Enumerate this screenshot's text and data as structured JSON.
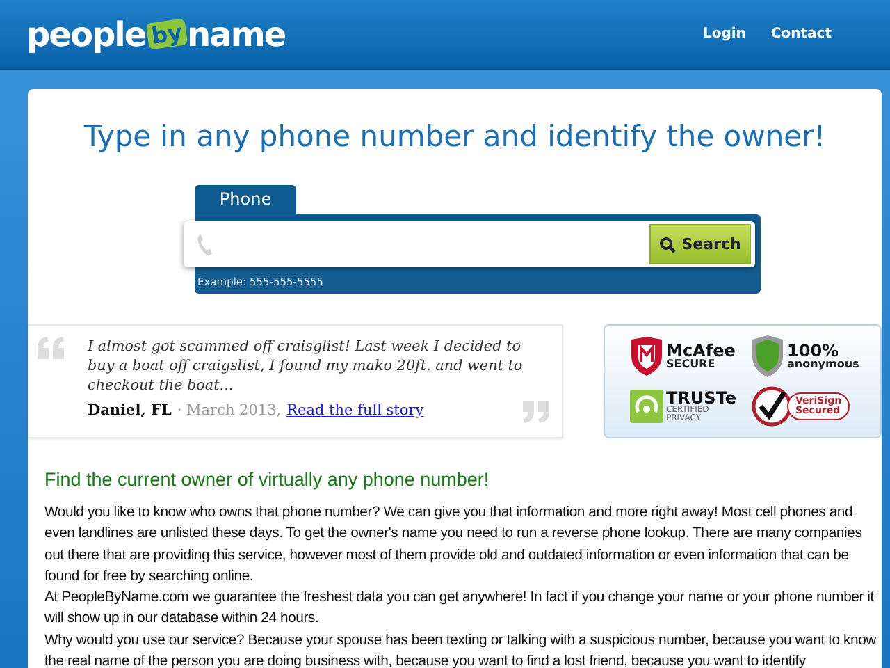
{
  "header": {
    "logo": {
      "part_1": "people",
      "part_2": "by",
      "part_3": "name"
    },
    "nav": [
      "Login",
      "Contact"
    ]
  },
  "title": "Type in any phone number and identify the owner!",
  "search": {
    "tabs": [
      {
        "label": "Phone",
        "selected": true
      }
    ],
    "button": "Search",
    "example": "Example: 555-555-5555"
  },
  "testimonial": {
    "quote": "I almost got scammed off craisglist! Last week I decided to buy a boat off craigslist, I found my mako 20ft. and went to checkout the boat...",
    "author": "Daniel, FL",
    "date": "· March 2013,",
    "link": "Read the full story"
  },
  "badges": [
    {
      "kind": "mcafee",
      "lines": [
        "McAfee",
        "SECURE"
      ]
    },
    {
      "kind": "anonymous",
      "lines": [
        "100%",
        "anonymous"
      ]
    },
    {
      "kind": "truste",
      "lines": [
        "TRUSTe",
        "CERTIFIED",
        "PRIVACY"
      ]
    },
    {
      "kind": "verisign",
      "lines": [
        "VeriSign",
        "Secured"
      ]
    }
  ],
  "content": {
    "heading": "Find the current owner of virtually any phone number!",
    "paragraphs": [
      "Would you like to know who owns that phone number? We can give you that information and more right away! Most cell phones and even landlines are unlisted these days. To get the owner's name you need to run a reverse phone lookup. There are many companies out there that are providing this service, however most of them provide old and outdated information or even information that can be found for free by searching online.",
      "At PeopleByName.com we guarantee the freshest data you can get anywhere! In fact if you change your name or your phone number it will show up in our database within 24 hours.",
      "Why would you use our service? Because your spouse has been texting or talking with a suspicious number, because you want to know the real name of the person you are doing business with, because you want to find a lost friend, because you want to identify"
    ]
  }
}
